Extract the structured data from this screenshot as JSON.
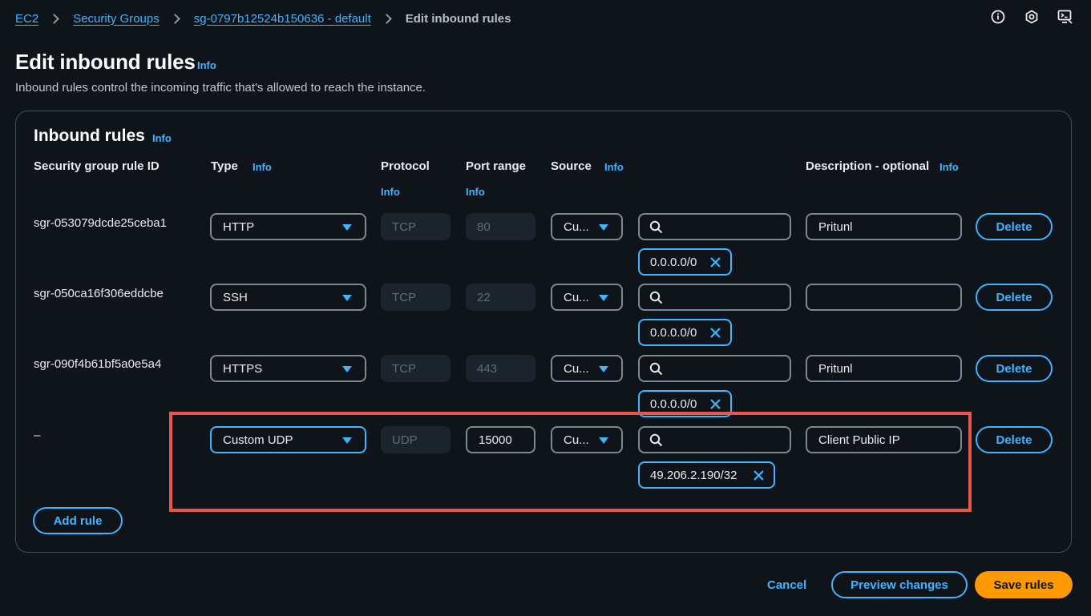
{
  "breadcrumb": {
    "items": [
      {
        "label": "EC2"
      },
      {
        "label": "Security Groups"
      },
      {
        "label": "sg-0797b12524b150636 - default"
      }
    ],
    "current": "Edit inbound rules"
  },
  "top_icons": [
    "info-circle-icon",
    "notification-icon",
    "cloudshell-icon"
  ],
  "page": {
    "title": "Edit inbound rules",
    "info": "Info",
    "description": "Inbound rules control the incoming traffic that's allowed to reach the instance."
  },
  "section": {
    "title": "Inbound rules",
    "info": "Info"
  },
  "columns": {
    "rule_id": "Security group rule ID",
    "type": "Type",
    "protocol": "Protocol",
    "port_range": "Port range",
    "source": "Source",
    "description": "Description - optional",
    "info": "Info"
  },
  "rules": [
    {
      "id": "sgr-053079dcde25ceba1",
      "type": "HTTP",
      "protocol": "TCP",
      "port": "80",
      "source": "Cu...",
      "cidr": "0.0.0.0/0",
      "description": "Pritunl",
      "delete": "Delete"
    },
    {
      "id": "sgr-050ca16f306eddcbe",
      "type": "SSH",
      "protocol": "TCP",
      "port": "22",
      "source": "Cu...",
      "cidr": "0.0.0.0/0",
      "description": "",
      "delete": "Delete"
    },
    {
      "id": "sgr-090f4b61bf5a0e5a4",
      "type": "HTTPS",
      "protocol": "TCP",
      "port": "443",
      "source": "Cu...",
      "cidr": "0.0.0.0/0",
      "description": "Pritunl",
      "delete": "Delete"
    },
    {
      "id": "–",
      "type": "Custom UDP",
      "protocol": "UDP",
      "port": "15000",
      "source": "Cu...",
      "cidr": "49.206.2.190/32",
      "description": "Client Public IP",
      "delete": "Delete"
    }
  ],
  "actions": {
    "add_rule": "Add rule",
    "cancel": "Cancel",
    "preview": "Preview changes",
    "save": "Save rules"
  },
  "colors": {
    "background": "#0f141a",
    "accent": "#42b4ff",
    "primary_button": "#ff9900",
    "highlight": "#e8574a"
  }
}
